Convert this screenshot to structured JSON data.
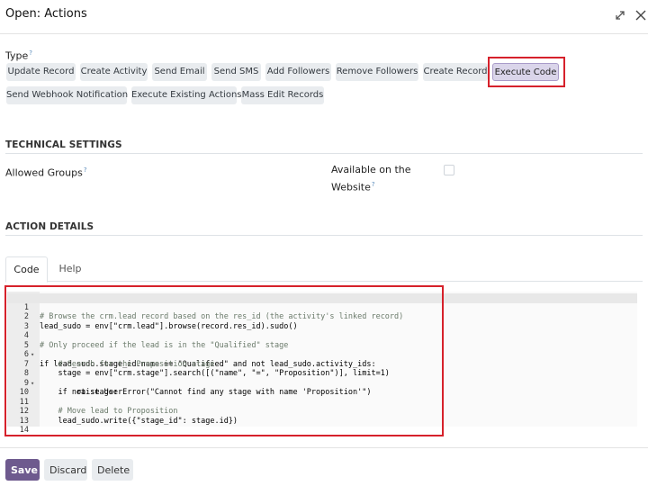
{
  "dialog": {
    "title": "Open: Actions"
  },
  "type": {
    "label": "Type",
    "help": "?",
    "row1": [
      "Update Record",
      "Create Activity",
      "Send Email",
      "Send SMS",
      "Add Followers",
      "Remove Followers",
      "Create Record",
      "Execute Code"
    ],
    "row2": [
      "Send Webhook Notification",
      "Execute Existing Actions",
      "Mass Edit Records"
    ],
    "selected": "Execute Code"
  },
  "technical": {
    "title": "TECHNICAL SETTINGS",
    "allowed_groups": "Allowed Groups",
    "available_line1": "Available on the",
    "available_line2": "Website",
    "help": "?"
  },
  "details": {
    "title": "ACTION DETAILS",
    "tabs": [
      "Code",
      "Help"
    ]
  },
  "code_lines": [
    "# Browse the crm.lead record based on the res_id (the activity's linked record)",
    "lead_sudo = env[\"crm.lead\"].browse(record.res_id).sudo()",
    "",
    "# Only proceed if the lead is in the \"Qualified\" stage",
    "if lead_sudo.stage_id.name == \"Qualified\" and not lead_sudo.activity_ids:",
    "    # Search for the Proposition stage",
    "    stage = env[\"crm.stage\"].search([(\"name\", \"=\", \"Proposition\")], limit=1)",
    "    if not stage:",
    "        raise UserError(\"Cannot find any stage with name 'Proposition'\")",
    "",
    "    # Move lead to Proposition",
    "    lead_sudo.write({\"stage_id\": stage.id})",
    "",
    ""
  ],
  "line_numbers": [
    "1",
    "2",
    "3",
    "4",
    "5",
    "6",
    "7",
    "8",
    "9",
    "10",
    "11",
    "12",
    "13",
    "14"
  ],
  "footer": {
    "save": "Save",
    "discard": "Discard",
    "delete": "Delete"
  },
  "colors": {
    "primary": "#6e5a8e",
    "highlight": "#d6212b"
  }
}
